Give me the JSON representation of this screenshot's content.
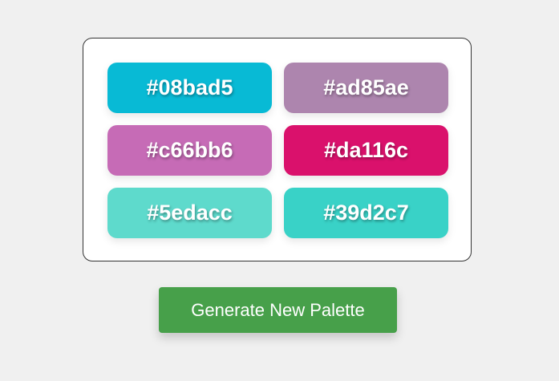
{
  "palette": {
    "swatches": [
      {
        "hex": "#08bad5",
        "color": "#08bad5"
      },
      {
        "hex": "#ad85ae",
        "color": "#ad85ae"
      },
      {
        "hex": "#c66bb6",
        "color": "#c66bb6"
      },
      {
        "hex": "#da116c",
        "color": "#da116c"
      },
      {
        "hex": "#5edacc",
        "color": "#5edacc"
      },
      {
        "hex": "#39d2c7",
        "color": "#39d2c7"
      }
    ]
  },
  "actions": {
    "generate_label": "Generate New Palette",
    "generate_color": "#47a04a"
  }
}
